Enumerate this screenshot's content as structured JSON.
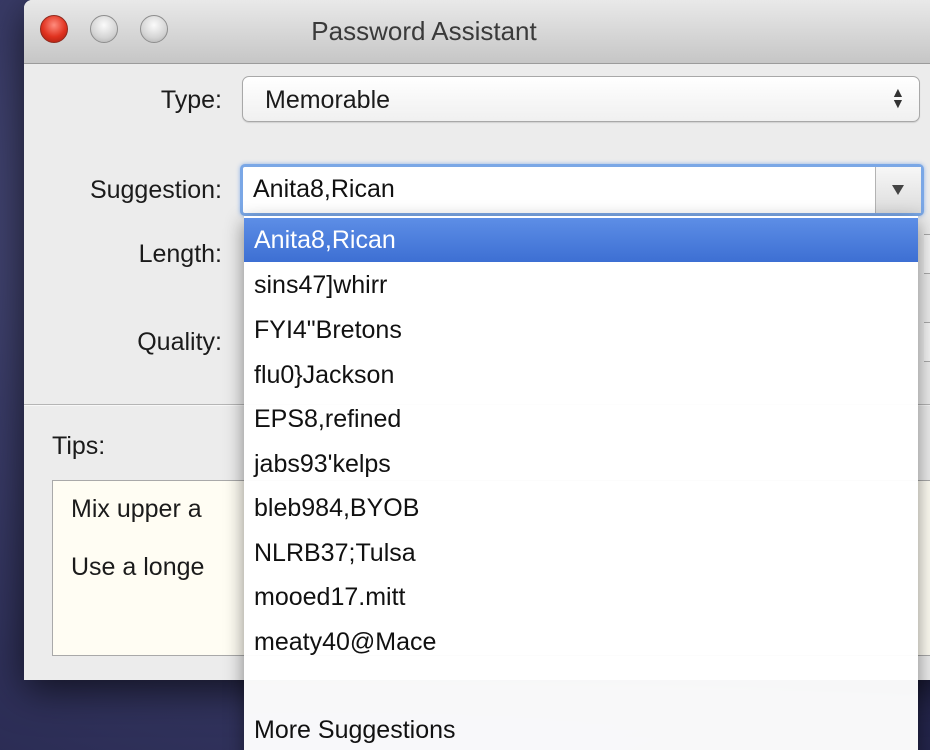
{
  "window": {
    "title": "Password Assistant"
  },
  "form": {
    "type_label": "Type:",
    "type_value": "Memorable",
    "suggestion_label": "Suggestion:",
    "suggestion_value": "Anita8,Rican",
    "length_label": "Length:",
    "quality_label": "Quality:",
    "tips_label": "Tips:"
  },
  "tips": {
    "line1": "Mix upper a",
    "line2": "Use a longe"
  },
  "dropdown": {
    "items": [
      "Anita8,Rican",
      "sins47]whirr",
      "FYI4\"Bretons",
      "flu0}Jackson",
      "EPS8,refined",
      "jabs93'kelps",
      "bleb984,BYOB",
      "NLRB37;Tulsa",
      "mooed17.mitt",
      "meaty40@Mace"
    ],
    "more_label": "More Suggestions",
    "selected_index": 0
  }
}
